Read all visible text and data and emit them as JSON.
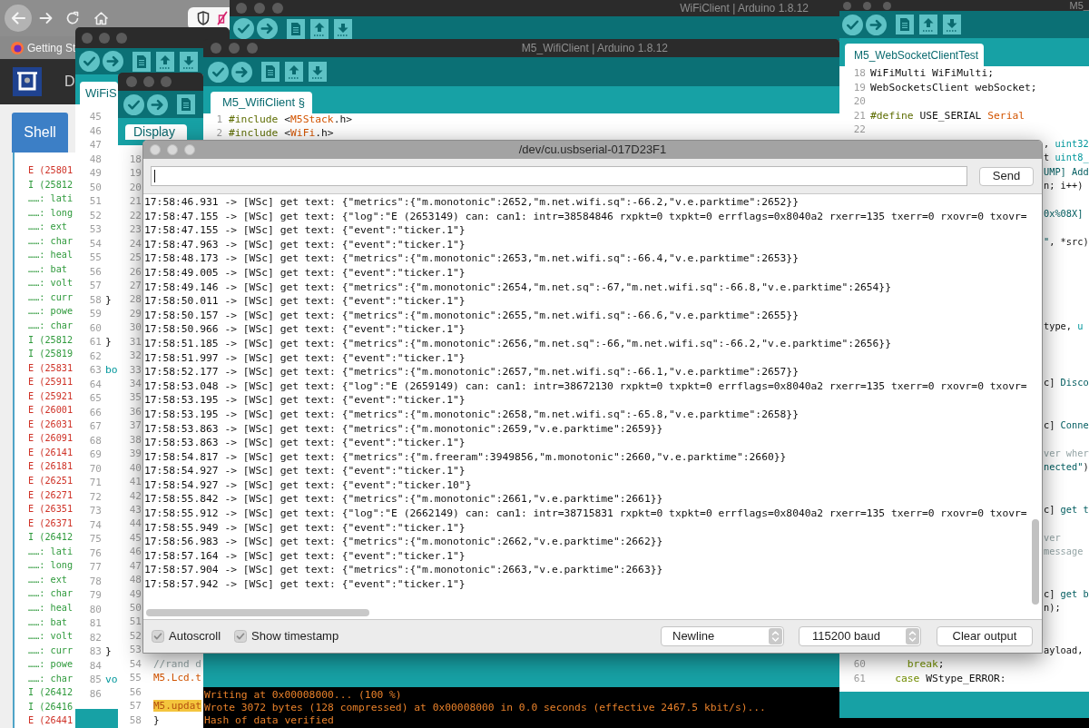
{
  "browser": {
    "bookmarks": [
      {
        "label": "Getting St"
      }
    ],
    "page": {
      "header_text": "D",
      "tabs": [
        {
          "label": "Shell",
          "selected": true
        }
      ],
      "log_lines": [
        {
          "kind": "error",
          "text": "E (25801"
        },
        {
          "kind": "info",
          "text": "I (25812"
        },
        {
          "kind": "detail",
          "text": "……: lati"
        },
        {
          "kind": "detail",
          "text": "……: long"
        },
        {
          "kind": "detail",
          "text": "……: ext"
        },
        {
          "kind": "detail",
          "text": "……: char"
        },
        {
          "kind": "detail",
          "text": "……: heal"
        },
        {
          "kind": "detail",
          "text": "……: bat"
        },
        {
          "kind": "detail",
          "text": "……: volt"
        },
        {
          "kind": "detail",
          "text": "……: curr"
        },
        {
          "kind": "detail",
          "text": "……: powe"
        },
        {
          "kind": "detail",
          "text": "……: char"
        },
        {
          "kind": "info",
          "text": "I (25812"
        },
        {
          "kind": "info",
          "text": "I (25819"
        },
        {
          "kind": "error",
          "text": "E (25831"
        },
        {
          "kind": "error",
          "text": "E (25911"
        },
        {
          "kind": "error",
          "text": "E (25921"
        },
        {
          "kind": "error",
          "text": "E (26001"
        },
        {
          "kind": "error",
          "text": "E (26031"
        },
        {
          "kind": "error",
          "text": "E (26091"
        },
        {
          "kind": "error",
          "text": "E (26141"
        },
        {
          "kind": "error",
          "text": "E (26181"
        },
        {
          "kind": "error",
          "text": "E (26251"
        },
        {
          "kind": "error",
          "text": "E (26271"
        },
        {
          "kind": "error",
          "text": "E (26351"
        },
        {
          "kind": "error",
          "text": "E (26371"
        },
        {
          "kind": "info",
          "text": "I (26412"
        },
        {
          "kind": "detail",
          "text": "……: lati"
        },
        {
          "kind": "detail",
          "text": "……: long"
        },
        {
          "kind": "detail",
          "text": "……: ext"
        },
        {
          "kind": "detail",
          "text": "……: char"
        },
        {
          "kind": "detail",
          "text": "……: heal"
        },
        {
          "kind": "detail",
          "text": "……: bat"
        },
        {
          "kind": "detail",
          "text": "……: volt"
        },
        {
          "kind": "detail",
          "text": "……: curr"
        },
        {
          "kind": "detail",
          "text": "……: powe"
        },
        {
          "kind": "detail",
          "text": "……: char"
        },
        {
          "kind": "info",
          "text": "I (26412"
        },
        {
          "kind": "info",
          "text": "I (26416"
        },
        {
          "kind": "error",
          "text": "E (26441"
        }
      ]
    }
  },
  "sketch_windows": [
    {
      "tab": {
        "label": "WiFiS",
        "selected": true
      },
      "rows": [
        {
          "number": "45"
        },
        {
          "number": "46"
        },
        {
          "number": "47"
        },
        {
          "number": "48"
        },
        {
          "number": "49"
        },
        {
          "number": "50"
        },
        {
          "number": "51"
        },
        {
          "number": "52"
        },
        {
          "number": "53"
        },
        {
          "number": "54"
        },
        {
          "number": "55"
        },
        {
          "number": "56"
        },
        {
          "number": "57"
        },
        {
          "number": "58",
          "code": [
            {
              "kind": "plain",
              "text": "}"
            }
          ]
        },
        {
          "number": "59"
        },
        {
          "number": "60"
        },
        {
          "number": "61",
          "code": [
            {
              "kind": "plain",
              "text": "}"
            }
          ]
        },
        {
          "number": "62"
        },
        {
          "number": "63",
          "code": [
            {
              "kind": "type",
              "text": "bo"
            }
          ]
        },
        {
          "number": "64"
        },
        {
          "number": "65"
        },
        {
          "number": "66"
        },
        {
          "number": "67"
        },
        {
          "number": "68"
        },
        {
          "number": "69"
        },
        {
          "number": "70"
        },
        {
          "number": "71"
        },
        {
          "number": "72"
        },
        {
          "number": "73"
        },
        {
          "number": "74"
        },
        {
          "number": "75"
        },
        {
          "number": "76"
        },
        {
          "number": "77"
        },
        {
          "number": "78"
        },
        {
          "number": "79"
        },
        {
          "number": "80"
        },
        {
          "number": "81"
        },
        {
          "number": "82"
        },
        {
          "number": "83",
          "code": [
            {
              "kind": "plain",
              "text": "}"
            }
          ]
        },
        {
          "number": "84"
        },
        {
          "number": "85",
          "code": [
            {
              "kind": "type",
              "text": "vo"
            }
          ]
        },
        {
          "number": "86"
        }
      ]
    },
    {
      "title": "WiFiClient | Arduino 1.8.12"
    },
    {
      "tab": {
        "label": "Display",
        "selected": true
      },
      "rows": [
        {
          "number": "18"
        },
        {
          "number": "19"
        },
        {
          "number": "20"
        },
        {
          "number": "21"
        },
        {
          "number": "22"
        },
        {
          "number": "23"
        },
        {
          "number": "24"
        },
        {
          "number": "25"
        },
        {
          "number": "26"
        },
        {
          "number": "27"
        },
        {
          "number": "28"
        },
        {
          "number": "29"
        },
        {
          "number": "30"
        },
        {
          "number": "31"
        },
        {
          "number": "32"
        },
        {
          "number": "33"
        },
        {
          "number": "34"
        },
        {
          "number": "35"
        },
        {
          "number": "36"
        },
        {
          "number": "37"
        },
        {
          "number": "38"
        },
        {
          "number": "39"
        },
        {
          "number": "40"
        },
        {
          "number": "41"
        },
        {
          "number": "42"
        },
        {
          "number": "43"
        },
        {
          "number": "44"
        },
        {
          "number": "45"
        },
        {
          "number": "46"
        },
        {
          "number": "47"
        },
        {
          "number": "48"
        },
        {
          "number": "49"
        },
        {
          "number": "50"
        },
        {
          "number": "51"
        },
        {
          "number": "52"
        },
        {
          "number": "53"
        },
        {
          "number": "54",
          "code": [
            {
              "kind": "comment",
              "text": "//rand d"
            }
          ]
        },
        {
          "number": "55",
          "code": [
            {
              "kind": "library",
              "text": "M5.Lcd.t"
            }
          ]
        },
        {
          "number": "56"
        },
        {
          "number": "57",
          "code": [
            {
              "kind": "highlight",
              "text": "M5.updat"
            }
          ]
        },
        {
          "number": "58",
          "code": [
            {
              "kind": "plain",
              "text": "}"
            }
          ]
        }
      ]
    },
    {
      "title": "M5_WifiClient | Arduino 1.8.12",
      "tab": {
        "label": "M5_WifiClient §",
        "selected": true
      },
      "rows": [
        {
          "number": "1",
          "code": [
            {
              "kind": "directive",
              "text": "#include"
            },
            {
              "kind": "plain",
              "text": " <"
            },
            {
              "kind": "library",
              "text": "M5Stack"
            },
            {
              "kind": "plain",
              "text": ".h>"
            }
          ]
        },
        {
          "number": "2",
          "code": [
            {
              "kind": "directive",
              "text": "#include"
            },
            {
              "kind": "plain",
              "text": " <"
            },
            {
              "kind": "library",
              "text": "WiFi"
            },
            {
              "kind": "plain",
              "text": ".h>"
            }
          ]
        }
      ],
      "console_lines": [
        "Writing at 0x00008000... (100 %)",
        "Wrote 3072 bytes (128 compressed) at 0x00008000 in 0.0 seconds (effective 2467.5 kbit/s)...",
        "Hash of data verified"
      ]
    },
    {
      "title": "M5_",
      "tab": {
        "label": "M5_WebSocketClientTest",
        "selected": true
      },
      "rows": [
        {
          "number": "18",
          "code": [
            {
              "kind": "plain",
              "text": "WiFiMulti WiFiMulti;"
            }
          ]
        },
        {
          "number": "19",
          "code": [
            {
              "kind": "plain",
              "text": "WebSocketsClient webSocket;"
            }
          ]
        },
        {
          "number": "20"
        },
        {
          "number": "21",
          "code": [
            {
              "kind": "directive",
              "text": "#define"
            },
            {
              "kind": "plain",
              "text": " USE_SERIAL "
            },
            {
              "kind": "library",
              "text": "Serial"
            }
          ]
        },
        {
          "number": "22"
        }
      ],
      "edge_fragments": [
        {
          "code": [
            {
              "kind": "plain",
              "text": ", "
            },
            {
              "kind": "type",
              "text": "uint32"
            }
          ]
        },
        {
          "code": [
            {
              "kind": "plain",
              "text": "t "
            },
            {
              "kind": "type",
              "text": "uint8_"
            }
          ]
        },
        {
          "code": [
            {
              "kind": "string",
              "text": "UMP] Add"
            }
          ]
        },
        {
          "code": [
            {
              "kind": "plain",
              "text": "n; i++)"
            }
          ]
        },
        {
          "code": [
            {
              "kind": "string",
              "text": "0x%08X]"
            }
          ]
        },
        {
          "code": [
            {
              "kind": "string",
              "text": "\""
            },
            {
              "kind": "plain",
              "text": ", *src)"
            }
          ]
        },
        {
          "code": [
            {
              "kind": "plain",
              "text": "type, "
            },
            {
              "kind": "type",
              "text": "u"
            }
          ]
        },
        {
          "code": [
            {
              "kind": "plain",
              "text": "c] "
            },
            {
              "kind": "string",
              "text": "Disco"
            }
          ]
        },
        {
          "code": [
            {
              "kind": "plain",
              "text": "c] "
            },
            {
              "kind": "string",
              "text": "Conne"
            }
          ]
        },
        {
          "code": [
            {
              "kind": "comment",
              "text": "ver wher"
            }
          ]
        },
        {
          "code": [
            {
              "kind": "string",
              "text": "nected\""
            },
            {
              "kind": "plain",
              "text": ")"
            }
          ]
        },
        {
          "code": [
            {
              "kind": "plain",
              "text": "c] "
            },
            {
              "kind": "string",
              "text": "get t"
            }
          ]
        },
        {
          "code": [
            {
              "kind": "comment",
              "text": "ver"
            }
          ]
        },
        {
          "code": [
            {
              "kind": "comment",
              "text": "message"
            }
          ]
        },
        {
          "code": [
            {
              "kind": "plain",
              "text": "c] "
            },
            {
              "kind": "string",
              "text": "get b"
            }
          ]
        },
        {
          "code": [
            {
              "kind": "plain",
              "text": "n);"
            }
          ]
        },
        {
          "code": [
            {
              "kind": "plain",
              "text": "ayload,"
            }
          ]
        }
      ],
      "rows_below": [
        {
          "number": "60",
          "code": [
            {
              "kind": "keyword",
              "text": "      break"
            },
            {
              "kind": "plain",
              "text": ";"
            }
          ]
        },
        {
          "number": "61",
          "code": [
            {
              "kind": "keyword",
              "text": "    case"
            },
            {
              "kind": "plain",
              "text": " WStype_ERROR:"
            }
          ]
        }
      ]
    }
  ],
  "serial_monitor": {
    "title": "/dev/cu.usbserial-017D23F1",
    "send_button": "Send",
    "output_lines": [
      "17:58:46.931 -> [WSc] get text: {\"metrics\":{\"m.monotonic\":2652,\"m.net.wifi.sq\":-66.2,\"v.e.parktime\":2652}}",
      "17:58:47.155 -> [WSc] get text: {\"log\":\"E (2653149) can: can1: intr=38584846 rxpkt=0 txpkt=0 errflags=0x8040a2 rxerr=135 txerr=0 rxovr=0 txovr=",
      "17:58:47.155 -> [WSc] get text: {\"event\":\"ticker.1\"}",
      "17:58:47.963 -> [WSc] get text: {\"event\":\"ticker.1\"}",
      "17:58:48.173 -> [WSc] get text: {\"metrics\":{\"m.monotonic\":2653,\"m.net.wifi.sq\":-66.4,\"v.e.parktime\":2653}}",
      "17:58:49.005 -> [WSc] get text: {\"event\":\"ticker.1\"}",
      "17:58:49.146 -> [WSc] get text: {\"metrics\":{\"m.monotonic\":2654,\"m.net.sq\":-67,\"m.net.wifi.sq\":-66.8,\"v.e.parktime\":2654}}",
      "17:58:50.011 -> [WSc] get text: {\"event\":\"ticker.1\"}",
      "17:58:50.157 -> [WSc] get text: {\"metrics\":{\"m.monotonic\":2655,\"m.net.wifi.sq\":-66.6,\"v.e.parktime\":2655}}",
      "17:58:50.966 -> [WSc] get text: {\"event\":\"ticker.1\"}",
      "17:58:51.185 -> [WSc] get text: {\"metrics\":{\"m.monotonic\":2656,\"m.net.sq\":-66,\"m.net.wifi.sq\":-66.2,\"v.e.parktime\":2656}}",
      "17:58:51.997 -> [WSc] get text: {\"event\":\"ticker.1\"}",
      "17:58:52.177 -> [WSc] get text: {\"metrics\":{\"m.monotonic\":2657,\"m.net.wifi.sq\":-66.1,\"v.e.parktime\":2657}}",
      "17:58:53.048 -> [WSc] get text: {\"log\":\"E (2659149) can: can1: intr=38672130 rxpkt=0 txpkt=0 errflags=0x8040a2 rxerr=135 txerr=0 rxovr=0 txovr=",
      "17:58:53.195 -> [WSc] get text: {\"event\":\"ticker.1\"}",
      "17:58:53.195 -> [WSc] get text: {\"metrics\":{\"m.monotonic\":2658,\"m.net.wifi.sq\":-65.8,\"v.e.parktime\":2658}}",
      "17:58:53.863 -> [WSc] get text: {\"metrics\":{\"m.monotonic\":2659,\"v.e.parktime\":2659}}",
      "17:58:53.863 -> [WSc] get text: {\"event\":\"ticker.1\"}",
      "17:58:54.817 -> [WSc] get text: {\"metrics\":{\"m.freeram\":3949856,\"m.monotonic\":2660,\"v.e.parktime\":2660}}",
      "17:58:54.927 -> [WSc] get text: {\"event\":\"ticker.1\"}",
      "17:58:54.927 -> [WSc] get text: {\"event\":\"ticker.10\"}",
      "17:58:55.842 -> [WSc] get text: {\"metrics\":{\"m.monotonic\":2661,\"v.e.parktime\":2661}}",
      "17:58:55.912 -> [WSc] get text: {\"log\":\"E (2662149) can: can1: intr=38715831 rxpkt=0 txpkt=0 errflags=0x8040a2 rxerr=135 txerr=0 rxovr=0 txovr=",
      "17:58:55.949 -> [WSc] get text: {\"event\":\"ticker.1\"}",
      "17:58:56.983 -> [WSc] get text: {\"metrics\":{\"m.monotonic\":2662,\"v.e.parktime\":2662}}",
      "17:58:57.164 -> [WSc] get text: {\"event\":\"ticker.1\"}",
      "17:58:57.904 -> [WSc] get text: {\"metrics\":{\"m.monotonic\":2663,\"v.e.parktime\":2663}}",
      "17:58:57.942 -> [WSc] get text: {\"event\":\"ticker.1\"}"
    ],
    "options": [
      {
        "label": "Autoscroll",
        "checked": true
      },
      {
        "label": "Show timestamp",
        "checked": true
      }
    ],
    "line_ending": "Newline",
    "baud_rate": "115200 baud",
    "clear_button": "Clear output"
  }
}
